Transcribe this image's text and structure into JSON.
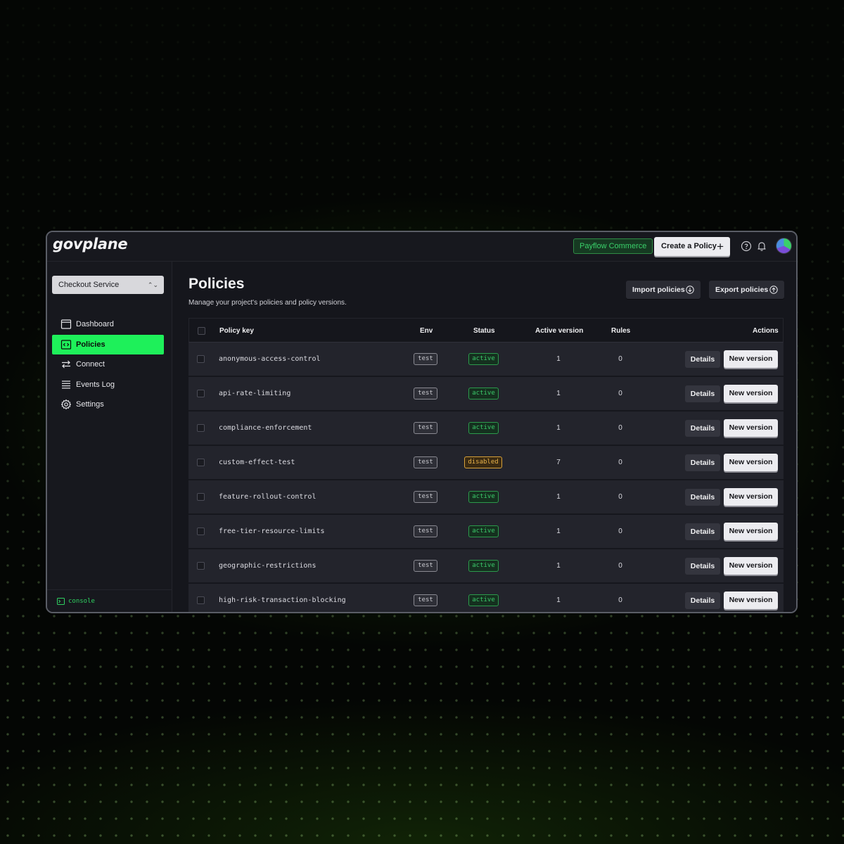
{
  "app": {
    "logo": "govplane"
  },
  "header": {
    "org_badge": "Payflow Commerce",
    "create_button": "Create a Policy",
    "icons": {
      "help": "help-circle-icon",
      "notifications": "bell-icon",
      "avatar": "avatar"
    }
  },
  "sidebar": {
    "project_select": "Checkout Service",
    "items": [
      {
        "label": "Dashboard",
        "icon": "dashboard-window-icon",
        "active": false
      },
      {
        "label": "Policies",
        "icon": "code-brackets-icon",
        "active": true
      },
      {
        "label": "Connect",
        "icon": "arrows-exchange-icon",
        "active": false
      },
      {
        "label": "Events Log",
        "icon": "list-icon",
        "active": false
      },
      {
        "label": "Settings",
        "icon": "gear-icon",
        "active": false
      }
    ],
    "footer_link": "console"
  },
  "main": {
    "title": "Policies",
    "subtitle": "Manage your project's policies and policy versions.",
    "import_button": "Import policies",
    "export_button": "Export policies"
  },
  "table": {
    "columns": {
      "policy_key": "Policy key",
      "env": "Env",
      "status": "Status",
      "active_version": "Active version",
      "rules": "Rules",
      "actions": "Actions"
    },
    "details_label": "Details",
    "new_version_label": "New version",
    "rows": [
      {
        "key": "anonymous-access-control",
        "env": "test",
        "status": "active",
        "version": "1",
        "rules": "0"
      },
      {
        "key": "api-rate-limiting",
        "env": "test",
        "status": "active",
        "version": "1",
        "rules": "0"
      },
      {
        "key": "compliance-enforcement",
        "env": "test",
        "status": "active",
        "version": "1",
        "rules": "0"
      },
      {
        "key": "custom-effect-test",
        "env": "test",
        "status": "disabled",
        "version": "7",
        "rules": "0"
      },
      {
        "key": "feature-rollout-control",
        "env": "test",
        "status": "active",
        "version": "1",
        "rules": "0"
      },
      {
        "key": "free-tier-resource-limits",
        "env": "test",
        "status": "active",
        "version": "1",
        "rules": "0"
      },
      {
        "key": "geographic-restrictions",
        "env": "test",
        "status": "active",
        "version": "1",
        "rules": "0"
      },
      {
        "key": "high-risk-transaction-blocking",
        "env": "test",
        "status": "active",
        "version": "1",
        "rules": "0"
      }
    ]
  },
  "colors": {
    "accent": "#1ef05a",
    "active_status": "#3bc86a",
    "disabled_status": "#e8b24a",
    "panel": "#15161c",
    "row": "#23242c"
  }
}
